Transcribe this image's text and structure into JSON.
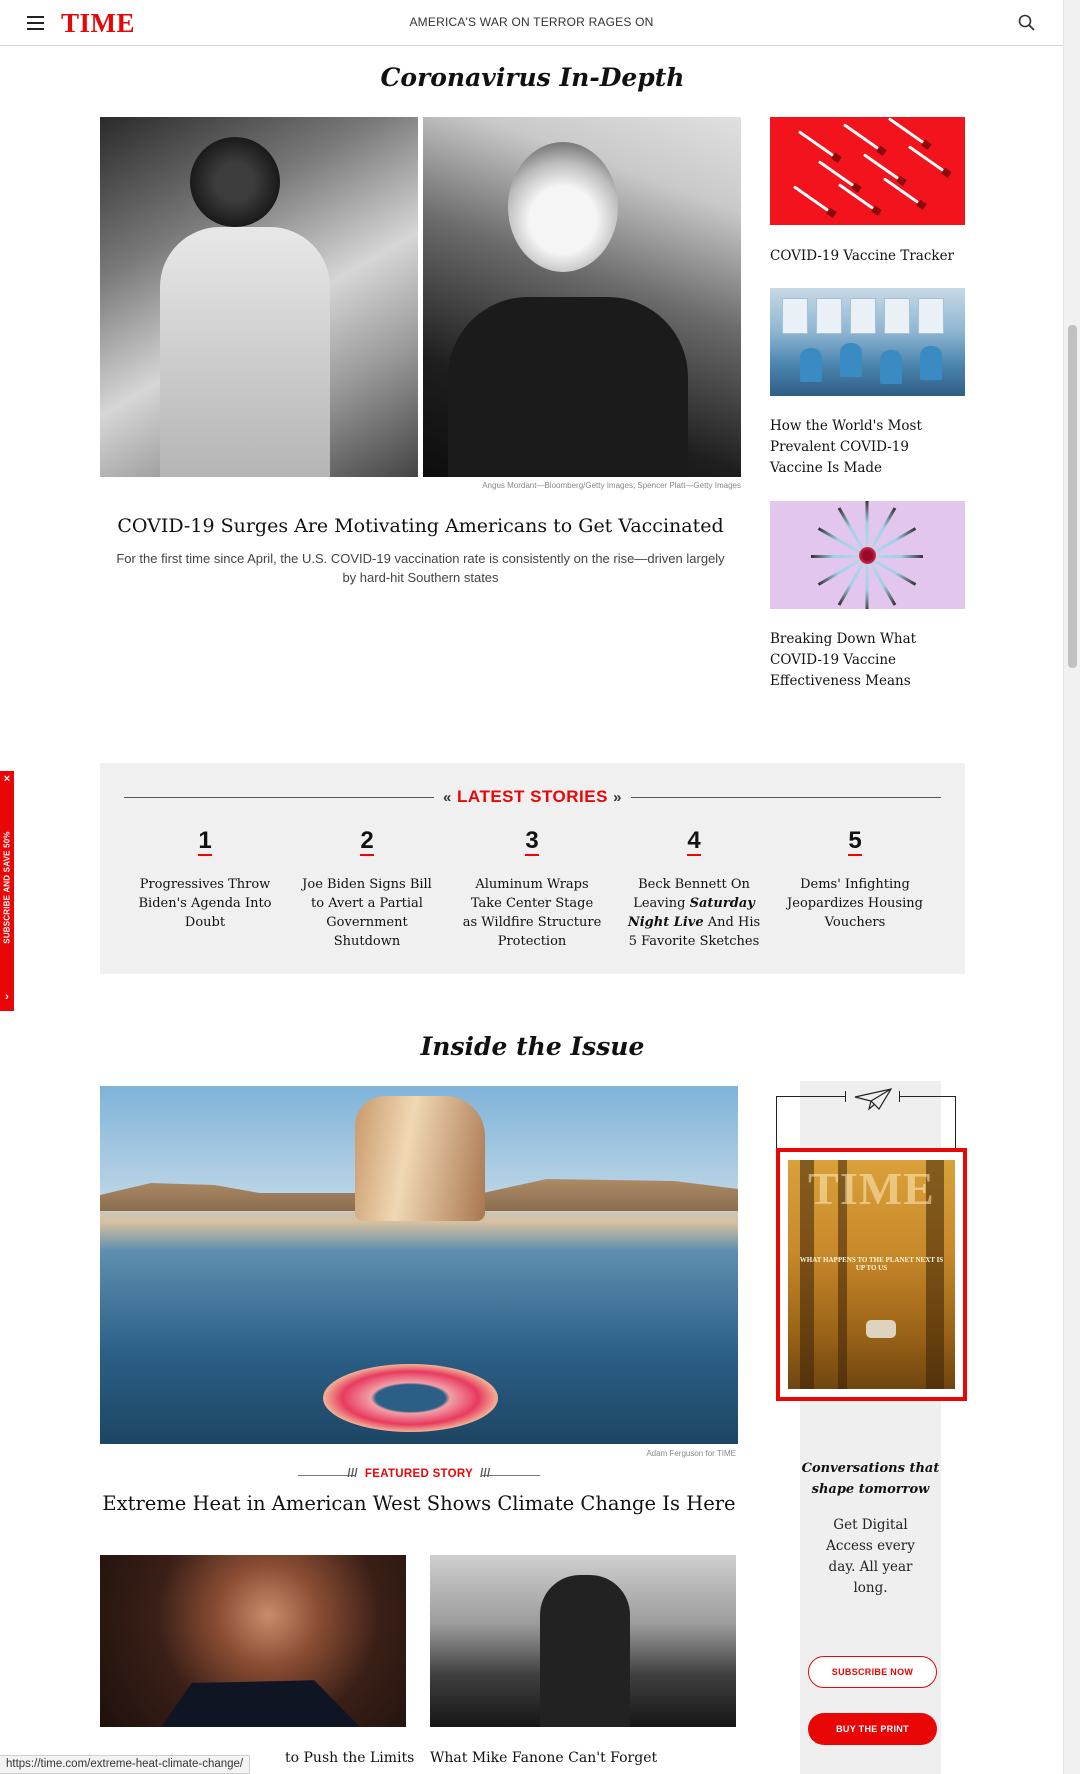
{
  "header": {
    "logo": "TIME",
    "tagline": "AMERICA'S WAR ON TERROR RAGES ON",
    "menu_icon": "hamburger-icon",
    "search_icon": "search-icon"
  },
  "coronavirus": {
    "title": "Coronavirus In-Depth",
    "hero": {
      "credit": "Angus Mordant—Bloomberg/Getty Images; Spencer Platt—Getty Images",
      "headline": "COVID-19 Surges Are Motivating Americans to Get Vaccinated",
      "dek": "For the first time since April, the U.S. COVID-19 vaccination rate is consistently on the rise—driven largely by hard-hit Southern states"
    },
    "side_stories": [
      {
        "title": "COVID-19 Vaccine Tracker"
      },
      {
        "title": "How the World's Most Prevalent COVID-19 Vaccine Is Made"
      },
      {
        "title": "Breaking Down What COVID-19 Vaccine Effectiveness Means"
      }
    ]
  },
  "latest": {
    "label": "LATEST STORIES",
    "items": [
      {
        "num": "1",
        "title": "Progressives Throw Biden's Agenda Into Doubt"
      },
      {
        "num": "2",
        "title": "Joe Biden Signs Bill to Avert a Partial Government Shutdown"
      },
      {
        "num": "3",
        "title": "Aluminum Wraps Take Center Stage as Wildfire Structure Protection"
      },
      {
        "num": "4",
        "title_pre": "Beck Bennett On Leaving ",
        "title_em": "Saturday Night Live",
        "title_post": " And His 5 Favorite Sketches"
      },
      {
        "num": "5",
        "title": "Dems' Infighting Jeopardizes Housing Vouchers"
      }
    ]
  },
  "issue": {
    "title": "Inside the Issue",
    "credit": "Adam Ferguson for TIME",
    "featured_label": "FEATURED STORY",
    "headline": "Extreme Heat in American West Shows Climate Change Is Here",
    "bottom_cards": [
      {
        "title_visible": "to Push the Limits"
      },
      {
        "title": "What Mike Fanone Can't Forget"
      }
    ]
  },
  "magazine": {
    "cover_logo": "TIME",
    "cover_text": "WHAT HAPPENS TO THE PLANET NEXT IS UP TO US",
    "tagline": "Conversations that shape tomorrow",
    "copy": "Get Digital Access every day. All year long.",
    "subscribe_label": "SUBSCRIBE NOW",
    "buy_label": "BUY THE PRINT",
    "plane_icon": "paper-plane-icon"
  },
  "promo_tab": {
    "text": "SUBSCRIBE AND SAVE 50%",
    "close": "×",
    "arrow": "›"
  },
  "status_url": "https://time.com/extreme-heat-climate-change/",
  "colors": {
    "brand_red": "#e90606",
    "panel_gray": "#f0f0f0"
  }
}
